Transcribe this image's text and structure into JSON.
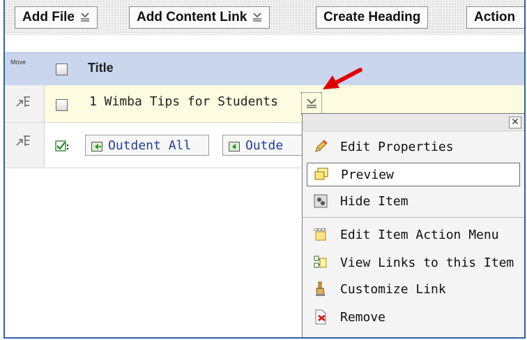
{
  "toolbar": {
    "add_file": "Add File",
    "add_content_link": "Add Content Link",
    "create_heading": "Create Heading",
    "action": "Action"
  },
  "table": {
    "move_label": "Move",
    "title_header": "Title",
    "item_title": "1 Wimba Tips for Students"
  },
  "outdent": {
    "all_label": "Outdent All",
    "selected_label": "Outde"
  },
  "menu": {
    "close": "✕",
    "items": [
      {
        "label": "Edit Properties",
        "icon": "pencil-icon"
      },
      {
        "label": "Preview",
        "icon": "preview-icon"
      },
      {
        "label": "Hide Item",
        "icon": "hide-icon"
      },
      {
        "label": "Edit Item Action Menu",
        "icon": "action-menu-icon"
      },
      {
        "label": "View Links to this Item",
        "icon": "links-icon"
      },
      {
        "label": "Customize Link",
        "icon": "customize-link-icon"
      },
      {
        "label": "Remove",
        "icon": "remove-icon"
      }
    ]
  },
  "colors": {
    "header_bg": "#c9d6ee",
    "row_highlight": "#fdfbe0",
    "link": "#1f3f9a",
    "annotation_arrow": "#e00000"
  }
}
